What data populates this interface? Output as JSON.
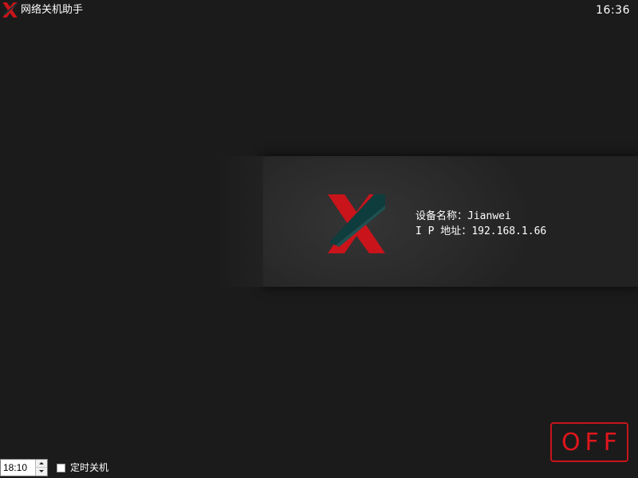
{
  "window": {
    "title": "网络关机助手",
    "clock": "16:36",
    "logo_icon": "x-logo-icon"
  },
  "device": {
    "name_label": "设备名称：",
    "name_value": "Jianwei",
    "ip_label": "I P 地址：",
    "ip_value": "192.168.1.66"
  },
  "controls": {
    "off_button_label": "OFF",
    "timer_value": "18:10",
    "timer_checkbox_label": "定时关机",
    "timer_checked": false
  },
  "colors": {
    "background": "#1b1b1b",
    "accent_red": "#c8141a",
    "logo_teal": "#0f3c3c"
  }
}
